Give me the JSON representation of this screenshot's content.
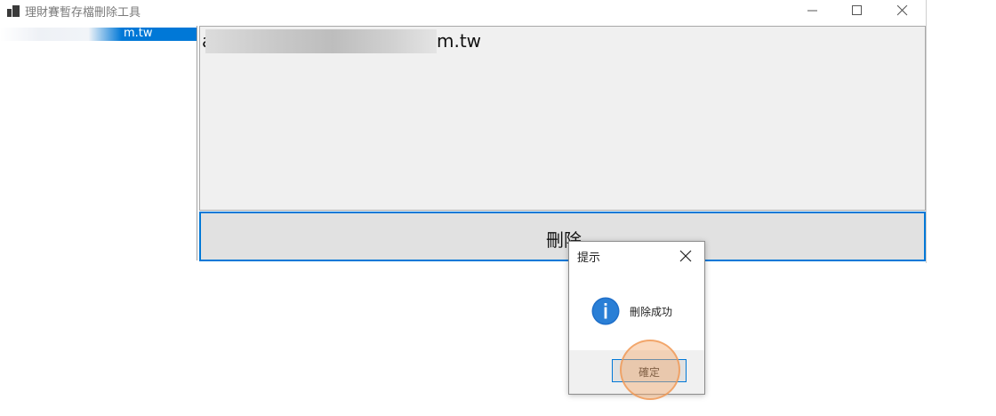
{
  "window": {
    "title": "理財賽暫存檔刪除工具",
    "controls": {
      "minimize_icon": "minimize-icon",
      "maximize_icon": "maximize-icon",
      "close_icon": "close-icon"
    }
  },
  "list": {
    "items": [
      {
        "label": "m.tw",
        "selected": true
      }
    ]
  },
  "textarea": {
    "first_char": "a",
    "text": "m.tw"
  },
  "delete_button": {
    "label": "刪除"
  },
  "dialog": {
    "title": "提示",
    "message": "刪除成功",
    "icon": "info-icon",
    "ok_label": "確定"
  },
  "colors": {
    "accent": "#0078d7",
    "dialog_footer": "#f0f0f0",
    "click_marker": "#f5aa6e"
  }
}
